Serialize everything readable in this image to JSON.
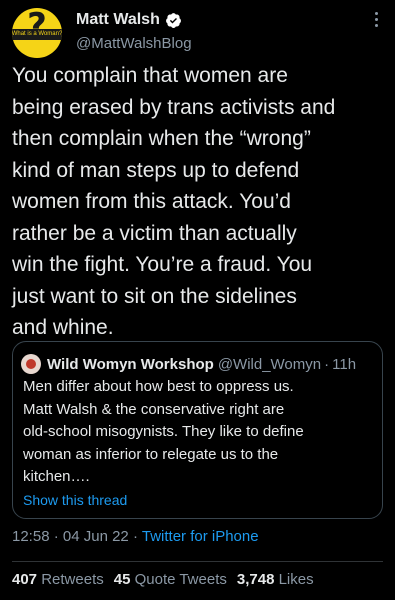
{
  "author": {
    "display_name": "Matt Walsh",
    "handle": "@MattWalshBlog",
    "avatar_band_text": "What is a Woman?",
    "avatar_symbol": "?",
    "verified_icon": "verified-badge-icon"
  },
  "tweet": {
    "text_lines": [
      "You complain that women are",
      "being erased by trans activists and",
      "then complain when the “wrong”",
      "kind of man steps up to defend",
      "women from this attack. You’d",
      "rather be a victim than actually",
      "win the fight. You’re a fraud. You",
      "just want to sit on the sidelines",
      "and whine."
    ]
  },
  "quoted": {
    "display_name": "Wild Womyn Workshop",
    "handle": "@Wild_Womyn",
    "separator": "·",
    "time": "11h",
    "text_lines": [
      "Men differ about how best to oppress us.",
      "Matt Walsh & the conservative right are",
      "old-school misogynists. They like to define",
      "woman as inferior to relegate us to the",
      "kitchen…."
    ],
    "show_thread": "Show this thread"
  },
  "meta": {
    "time": "12:58",
    "separator": "·",
    "date": "04 Jun 22",
    "source": "Twitter for iPhone"
  },
  "stats": {
    "retweets_count": "407",
    "retweets_label": "Retweets",
    "quotes_count": "45",
    "quotes_label": "Quote Tweets",
    "likes_count": "3,748",
    "likes_label": "Likes"
  },
  "colors": {
    "background": "#000000",
    "text": "#e7e9ea",
    "secondary": "#8b98a5",
    "link": "#1d9bf0",
    "avatar_yellow": "#f5d417"
  }
}
